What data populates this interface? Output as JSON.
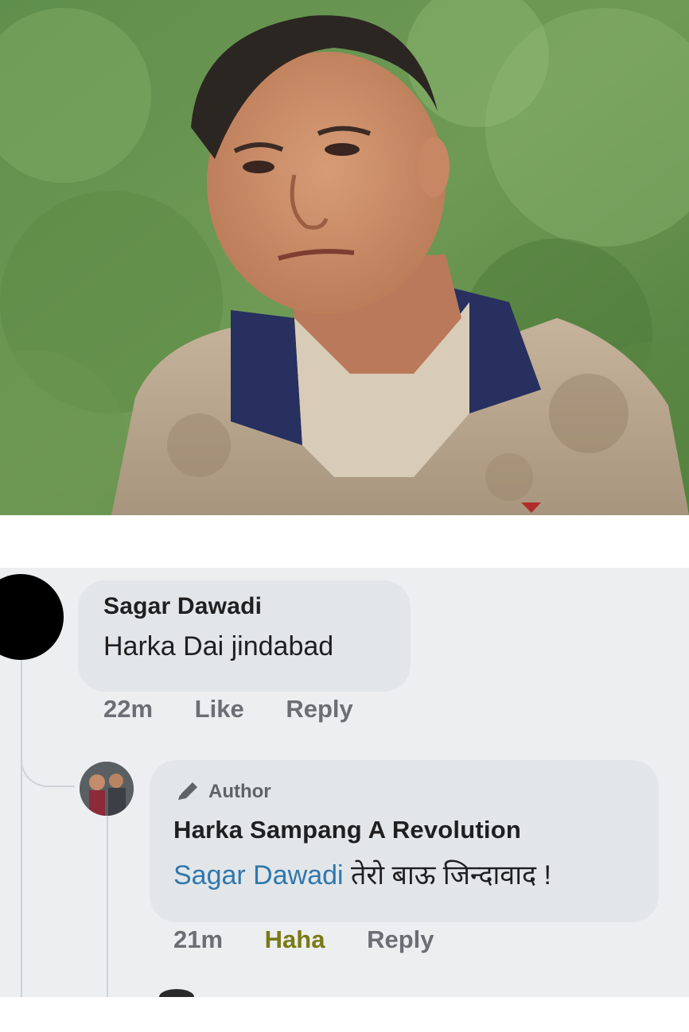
{
  "photo": {
    "subject": "man-in-dirty-polo-shirt",
    "background": "green-foliage"
  },
  "comment": {
    "author": "Sagar Dawadi",
    "text": "Harka Dai jindabad",
    "time": "22m",
    "like_label": "Like",
    "reply_label": "Reply"
  },
  "reply": {
    "badge": "Author",
    "author": "Harka Sampang A Revolution",
    "mention": "Sagar Dawadi",
    "text": " तेरो बाऊ जिन्दावाद !",
    "time": "21m",
    "reaction_label": "Haha",
    "reply_label": "Reply"
  },
  "colors": {
    "comment_bg": "#eceef0",
    "bubble": "#e3e6e9",
    "mention": "#2f78ad",
    "haha": "#7a7a14"
  }
}
